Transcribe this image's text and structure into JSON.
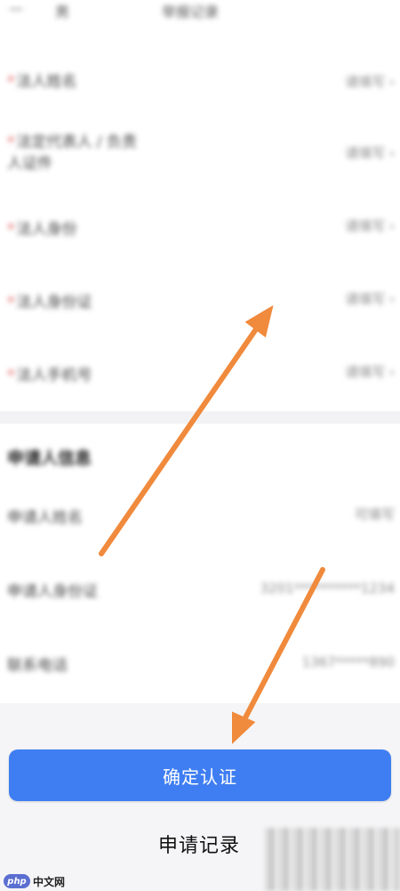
{
  "top_bar": {
    "left_text": "—",
    "mid_text": "男",
    "right_text": "举报记录"
  },
  "form_rows": [
    {
      "label": "法人姓名",
      "value": "请填写 ›"
    },
    {
      "label": "法定代表人 / 负责人证件",
      "value": "请填写 ›"
    },
    {
      "label": "法人身份",
      "value": "请填写 ›"
    },
    {
      "label": "法人身份证",
      "value": "请填写 ›"
    },
    {
      "label": "法人手机号",
      "value": "请填写 ›"
    }
  ],
  "applicant_section": {
    "title": "申请人信息",
    "rows": [
      {
        "label": "申请人姓名",
        "value": "可填写"
      },
      {
        "label": "申请人身份证",
        "value": "3201**********1234"
      },
      {
        "label": "联系电话",
        "value": "1367*****890"
      }
    ]
  },
  "buttons": {
    "confirm": "确定认证",
    "records": "申请记录"
  },
  "watermark": {
    "logo_text": "php",
    "site": "中文网"
  },
  "colors": {
    "accent": "#3f7ef2",
    "arrow": "#f08a3c",
    "required": "#e05252"
  }
}
